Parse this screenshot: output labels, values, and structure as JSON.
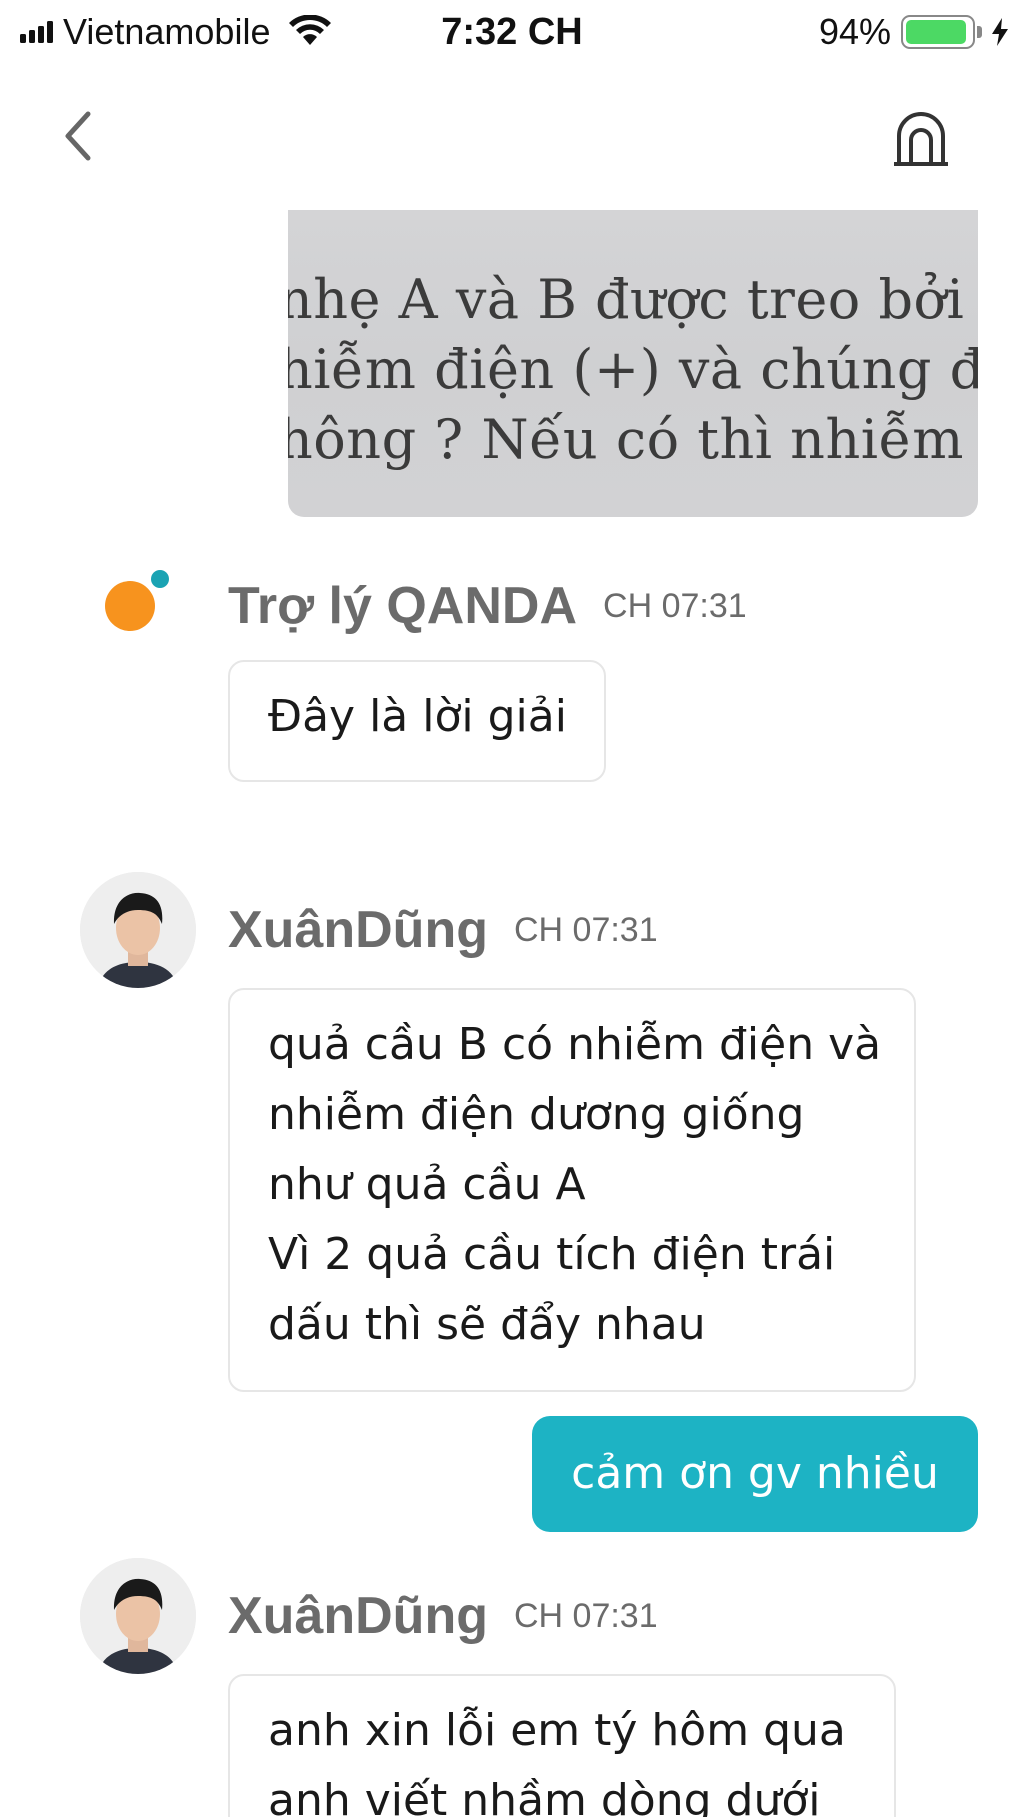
{
  "status_bar": {
    "carrier": "Vietnamobile",
    "time": "7:32 CH",
    "battery_percent": "94%",
    "battery_level": 0.94,
    "battery_color": "#4cd964",
    "signal_icon": "signal-bars-icon",
    "wifi_icon": "wifi-icon",
    "charging_icon": "charging-bolt-icon"
  },
  "nav": {
    "back_icon": "chevron-left-icon",
    "right_icon": "arch-icon"
  },
  "question_photo": {
    "lines": [
      "nhẹ A và B được treo bởi h",
      "hiễm điện (+) và chúng đẩy",
      "hông ? Nếu có thì nhiễm điệ"
    ]
  },
  "messages": [
    {
      "sender": "Trợ lý QANDA",
      "time": "CH 07:31",
      "avatar_icon": "qanda-logo-icon",
      "lines": [
        "Đây là lời giải"
      ]
    },
    {
      "sender": "XuânDũng",
      "time": "CH 07:31",
      "avatar_icon": "tutor-avatar",
      "lines": [
        "quả cầu B có nhiễm điện và",
        "nhiễm điện dương giống",
        "như quả cầu A",
        "Vì 2 quả cầu tích điện trái",
        "dấu thì sẽ đẩy nhau"
      ]
    },
    {
      "outgoing": true,
      "text": "cảm ơn gv nhiều"
    },
    {
      "sender": "XuânDũng",
      "time": "CH 07:31",
      "avatar_icon": "tutor-avatar",
      "lines": [
        "anh xin lỗi em tý hôm qua",
        "anh viết nhầm dòng dưới"
      ]
    }
  ],
  "colors": {
    "accent": "#1db3c4",
    "qanda_orange": "#f7931e",
    "qanda_teal": "#1aa3b3",
    "name_gray": "#6b6b6b",
    "bubble_border": "#e6e6e6"
  }
}
